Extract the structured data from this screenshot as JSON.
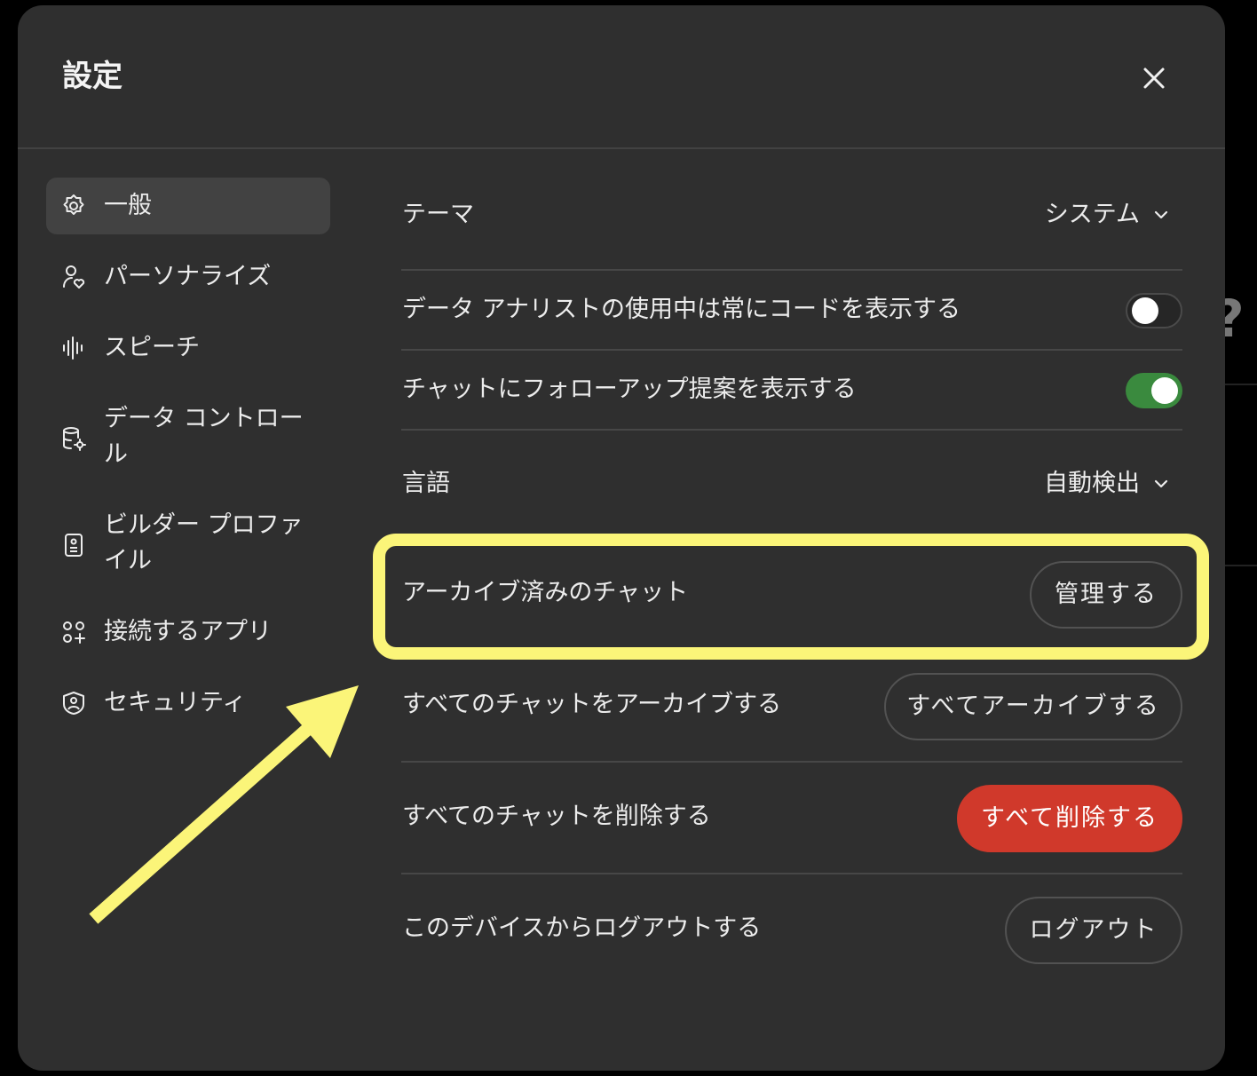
{
  "colors": {
    "modal_bg": "#2f2f2f",
    "toggle_on": "#3a8a3e",
    "danger": "#d0392b",
    "highlight": "#fbf579"
  },
  "header": {
    "title": "設定",
    "close_icon": "close-icon"
  },
  "sidebar": {
    "items": [
      {
        "label": "一般",
        "icon": "gear-icon",
        "active": true
      },
      {
        "label": "パーソナライズ",
        "icon": "person-heart-icon",
        "active": false
      },
      {
        "label": "スピーチ",
        "icon": "waveform-icon",
        "active": false
      },
      {
        "label": "データ コントロール",
        "icon": "database-gear-icon",
        "active": false
      },
      {
        "label": "ビルダー プロファイル",
        "icon": "id-card-icon",
        "active": false
      },
      {
        "label": "接続するアプリ",
        "icon": "apps-icon",
        "active": false
      },
      {
        "label": "セキュリティ",
        "icon": "shield-lock-icon",
        "active": false
      }
    ]
  },
  "settings": {
    "theme": {
      "label": "テーマ",
      "value": "システム"
    },
    "show_code": {
      "label": "データ アナリストの使用中は常にコードを表示する",
      "enabled": false
    },
    "follow_up": {
      "label": "チャットにフォローアップ提案を表示する",
      "enabled": true
    },
    "language": {
      "label": "言語",
      "value": "自動検出"
    },
    "archived": {
      "label": "アーカイブ済みのチャット",
      "button": "管理する"
    },
    "archive_all": {
      "label": "すべてのチャットをアーカイブする",
      "button": "すべてアーカイブする"
    },
    "delete_all": {
      "label": "すべてのチャットを削除する",
      "button": "すべて削除する"
    },
    "logout": {
      "label": "このデバイスからログアウトする",
      "button": "ログアウト"
    }
  },
  "annotations": {
    "highlight_target": "archived",
    "arrow_icon": "arrow-icon"
  }
}
